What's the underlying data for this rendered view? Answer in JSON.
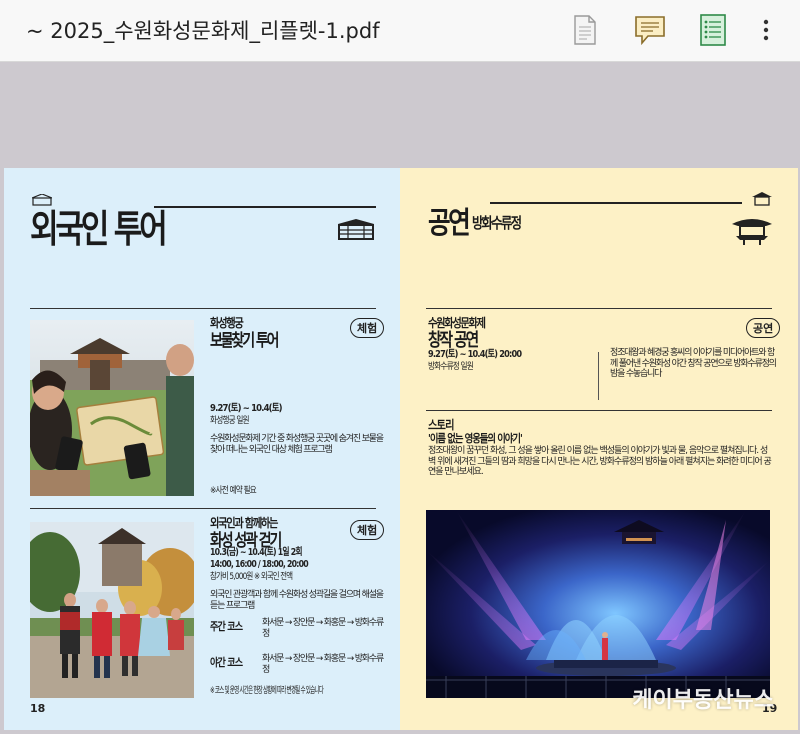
{
  "toolbar": {
    "title": "~ 2025_수원화성문화제_리플렛-1.pdf",
    "icons": [
      "page-icon",
      "comment-icon",
      "outline-icon",
      "more-icon"
    ]
  },
  "left_page": {
    "heading": "외국인 투어",
    "section1": {
      "title_top": "화성행궁",
      "title_main": "보물찾기 투어",
      "tag": "체험",
      "date": "9.27(토) ~ 10.4(토)",
      "place": "화성행궁 일원",
      "desc": "수원화성문화제 기간 중 화성행궁 곳곳에 숨겨진 보물을 찾아 떠나는 외국인 대상 체험 프로그램",
      "note": "※사전 예약 필요"
    },
    "section2": {
      "title_top": "외국인과 함께하는",
      "title_main": "화성 성곽 걷기",
      "tag": "체험",
      "date": "10.3(금) ~ 10.4(토) 1일 2회",
      "times": "14:00, 16:00 / 18:00, 20:00",
      "fee": "참가비 5,000원 ※ 외국인 전액",
      "desc": "외국인 관광객과 함께 수원화성 성곽길을 걸으며 해설을 듣는 프로그램",
      "route1_label": "주간 코스",
      "route1": "화서문 → 장안문 → 화홍문 → 방화수류정",
      "route2_label": "야간 코스",
      "route2": "화서문 → 장안문 → 화홍문 → 방화수류정",
      "note": "※ 코스 및 운영 시간은 현장 상황에 따라 변경될 수 있습니다"
    },
    "page_number": "18"
  },
  "right_page": {
    "heading": "공연",
    "heading_sub": "방화수류정",
    "section1": {
      "title_top": "수원화성문화제",
      "title_main": "창작 공연",
      "tag": "공연",
      "date": "9.27(토) ~ 10.4(토) 20:00",
      "place": "방화수류정 일원",
      "desc_right": "정조대왕과 혜경궁 홍씨의 이야기를 미디어아트와 함께 풀어낸 수원화성 야간 창작 공연으로 방화수류정의 밤을 수놓습니다"
    },
    "story": {
      "label": "스토리",
      "headline": "'이름 없는 영웅들의 이야기'",
      "body": "정조대왕이 꿈꾸던 화성, 그 성을 쌓아 올린 이름 없는 백성들의 이야기가 빛과 물, 음악으로 펼쳐집니다. 성벽 위에 새겨진 그들의 땀과 희망을 다시 만나는 시간, 방화수류정의 밤하늘 아래 펼쳐지는 화려한 미디어 공연을 만나보세요."
    },
    "page_number": "19"
  },
  "watermark": "케이부동산뉴스"
}
